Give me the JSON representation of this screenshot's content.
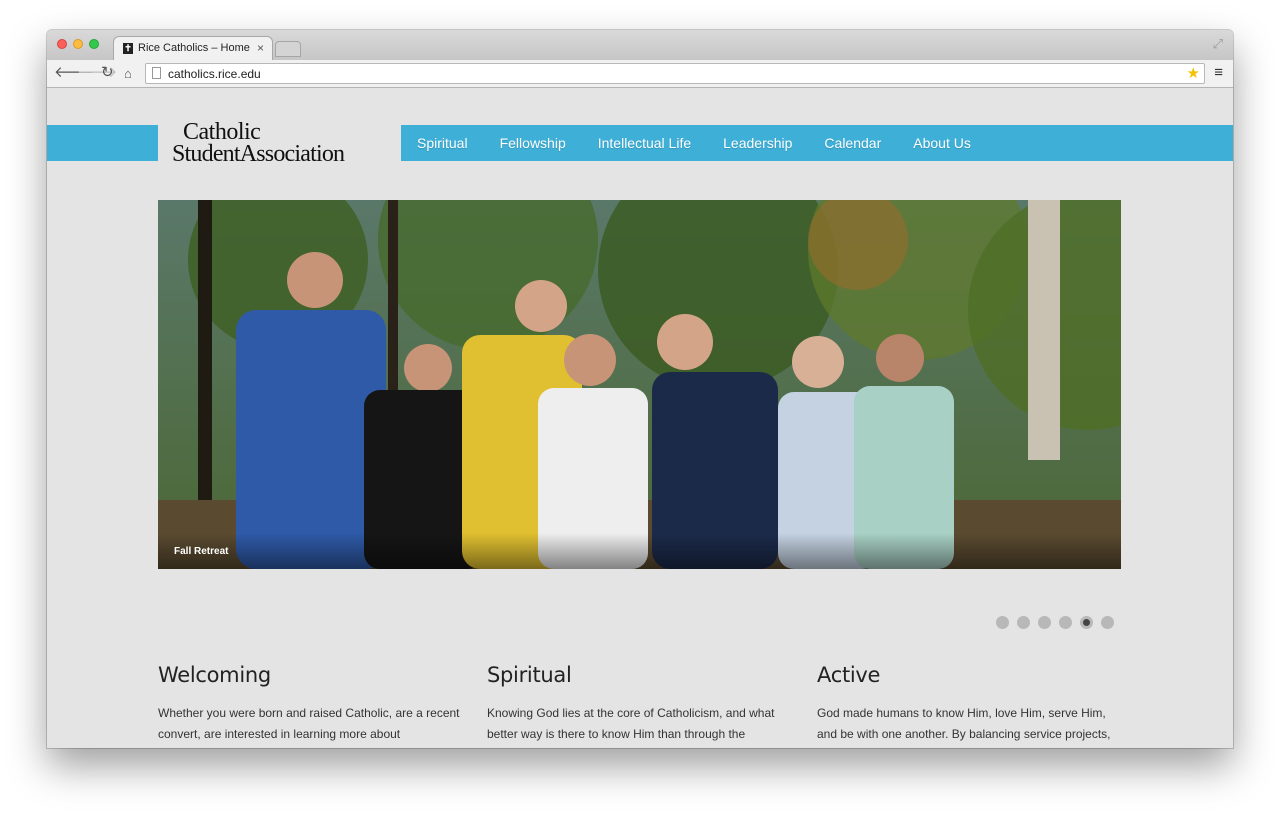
{
  "browser": {
    "tab_title": "Rice Catholics – Home",
    "tab_close": "×",
    "url": "catholics.rice.edu",
    "icons": {
      "back": "back-arrow-icon",
      "forward": "forward-arrow-icon",
      "reload": "reload-icon",
      "home": "home-icon",
      "bookmark": "star-icon",
      "menu": "hamburger-menu-icon",
      "fullscreen": "fullscreen-icon"
    }
  },
  "site": {
    "logo_line1": "Catholic",
    "logo_line2": "StudentAssociation",
    "nav": [
      "Spiritual",
      "Fellowship",
      "Intellectual Life",
      "Leadership",
      "Calendar",
      "About Us"
    ],
    "accent_color": "#3eafd7"
  },
  "hero": {
    "caption": "Fall Retreat",
    "slide_count": 6,
    "active_slide": 5
  },
  "columns": [
    {
      "title": "Welcoming",
      "text": "Whether you were born and raised Catholic, are a recent convert, are interested in learning more about Catholicism, or simply want to meet new people, the CSA invites you to come as you are. Through both faith and"
    },
    {
      "title": "Spiritual",
      "text": "Knowing God lies at the core of Catholicism, and what better way is there to know Him than through the Sacraments? By praising Him at Mass on Sundays, spending time with Him during the week at weekday"
    },
    {
      "title": "Active",
      "text": "God made humans to know Him, love Him, serve Him, and be with one another. By balancing service projects, retreats, small groups, and prayer with movie nights, dinners, and other social outings, we enact God's mission"
    }
  ]
}
